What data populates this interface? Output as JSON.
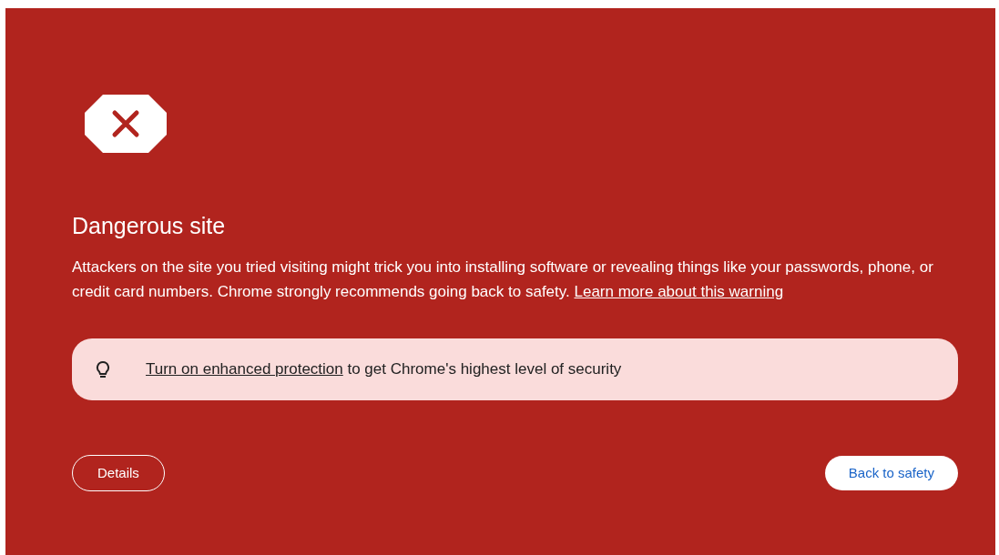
{
  "title": "Dangerous site",
  "message": {
    "text": "Attackers on the site you tried visiting might trick you into installing software or revealing things like your passwords, phone, or credit card numbers. Chrome strongly recommends going back to safety.",
    "link": "Learn more about this warning"
  },
  "banner": {
    "link": "Turn on enhanced protection",
    "text": "to get Chrome's highest level of security"
  },
  "buttons": [
    {
      "label": "Details",
      "kind": "outline"
    },
    {
      "label": "Back to safety",
      "kind": "primary"
    }
  ]
}
